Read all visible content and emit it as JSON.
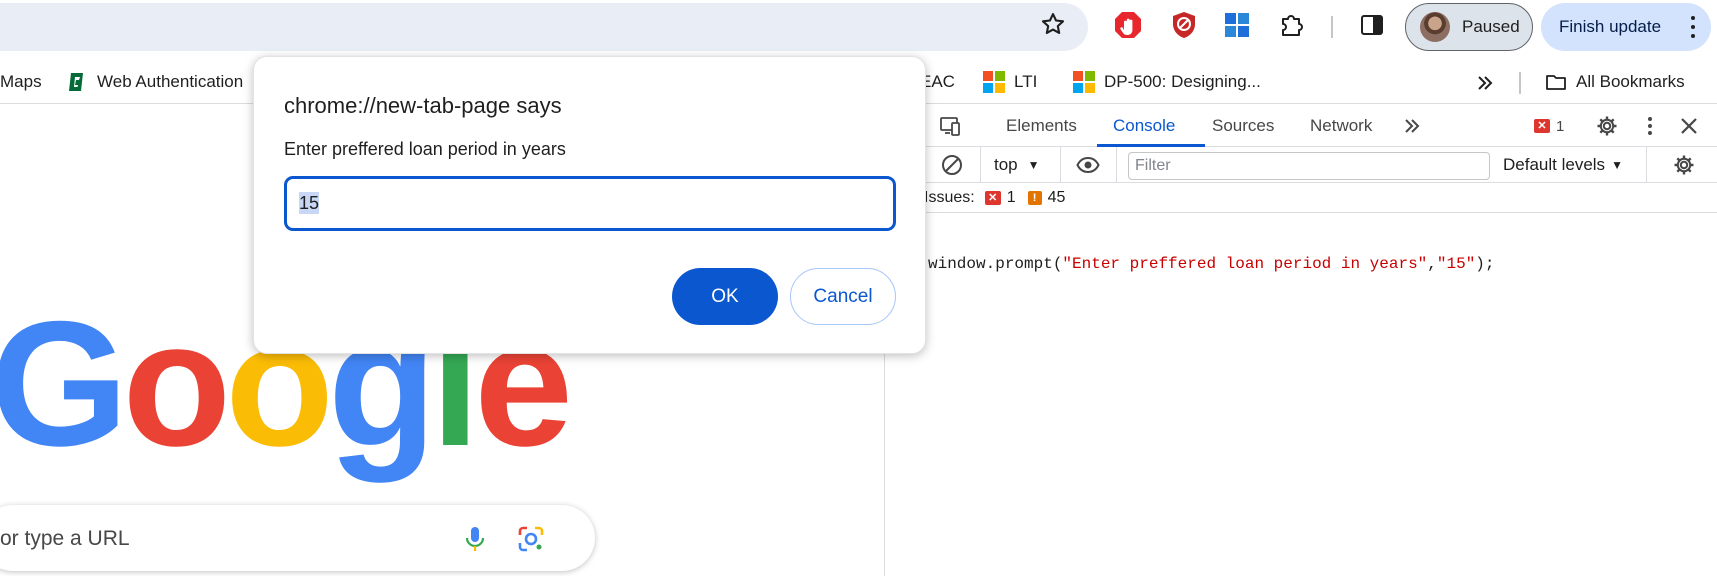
{
  "toolbar": {
    "profile_status": "Paused",
    "update_button": "Finish update"
  },
  "bookmarks": {
    "items": [
      {
        "label": "Maps"
      },
      {
        "label": "Web Authentication"
      },
      {
        "label": "EAC"
      },
      {
        "label": "LTI"
      },
      {
        "label": "DP-500: Designing..."
      }
    ],
    "all_bookmarks": "All Bookmarks"
  },
  "page": {
    "logo_letters": [
      "G",
      "o",
      "o",
      "g",
      "l",
      "e"
    ],
    "logo_colors": [
      "#4285f4",
      "#ea4335",
      "#fbbc05",
      "#4285f4",
      "#34a853",
      "#ea4335"
    ],
    "search_placeholder": "or type a URL"
  },
  "devtools": {
    "tabs": [
      "Elements",
      "Console",
      "Sources",
      "Network"
    ],
    "active_tab": "Console",
    "error_count": "1",
    "context": "top",
    "filter_placeholder": "Filter",
    "levels": "Default levels",
    "issues_label": "Issues:",
    "issues_errors": "1",
    "issues_warnings": "45",
    "console_code_prefix": "window.prompt(",
    "console_arg1": "\"Enter preffered loan period in years\"",
    "console_comma": ",",
    "console_arg2": "\"15\"",
    "console_code_suffix": ");",
    "colors": {
      "string": "#c80000",
      "accent": "#0b57d0"
    }
  },
  "dialog": {
    "title": "chrome://new-tab-page says",
    "message": "Enter preffered loan period in years",
    "input_value": "15",
    "ok_label": "OK",
    "cancel_label": "Cancel"
  }
}
